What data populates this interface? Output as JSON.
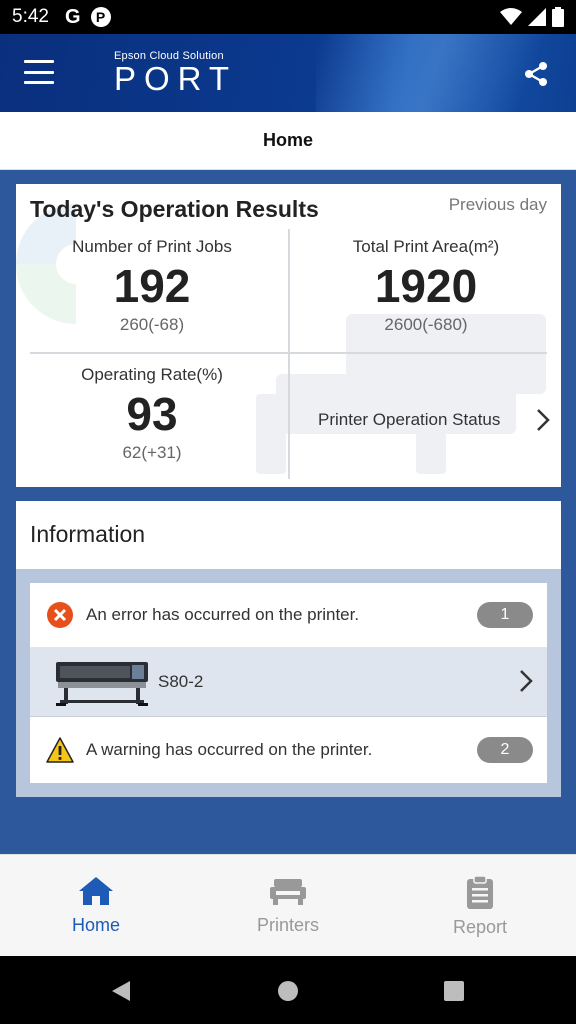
{
  "status_bar": {
    "time": "5:42",
    "g_icon": "G",
    "p_icon": "P"
  },
  "app_bar": {
    "brand_small": "Epson Cloud Solution",
    "brand_big": "PORT",
    "menu_icon": "hamburger-menu-icon",
    "share_icon": "share-icon"
  },
  "page": {
    "title": "Home"
  },
  "results": {
    "title": "Today's Operation Results",
    "previous_label": "Previous day",
    "print_jobs": {
      "label": "Number of Print Jobs",
      "value": "192",
      "previous": "260(-68)"
    },
    "print_area": {
      "label": "Total Print Area(m²)",
      "value": "1920",
      "previous": "2600(-680)"
    },
    "operating_rate": {
      "label": "Operating Rate(%)",
      "value": "93",
      "previous": "62(+31)"
    },
    "operation_status_link": "Printer Operation Status"
  },
  "information": {
    "title": "Information",
    "error": {
      "message": "An error has occurred on the printer.",
      "count": "1",
      "icon": "error-x-icon",
      "color": "#e8501b"
    },
    "printer": {
      "name": "S80-2"
    },
    "warning": {
      "message": "A warning has occurred on the printer.",
      "count": "2",
      "icon": "warning-triangle-icon",
      "color": "#f5c518"
    }
  },
  "bottom_nav": {
    "items": [
      {
        "label": "Home",
        "icon": "home-icon",
        "active": true
      },
      {
        "label": "Printers",
        "icon": "printer-icon",
        "active": false
      },
      {
        "label": "Report",
        "icon": "clipboard-icon",
        "active": false
      }
    ],
    "active_color": "#1d5bb6",
    "inactive_color": "#999999"
  },
  "colors": {
    "app_bar": "#0b3a8f",
    "content_bg": "#2e589c"
  }
}
